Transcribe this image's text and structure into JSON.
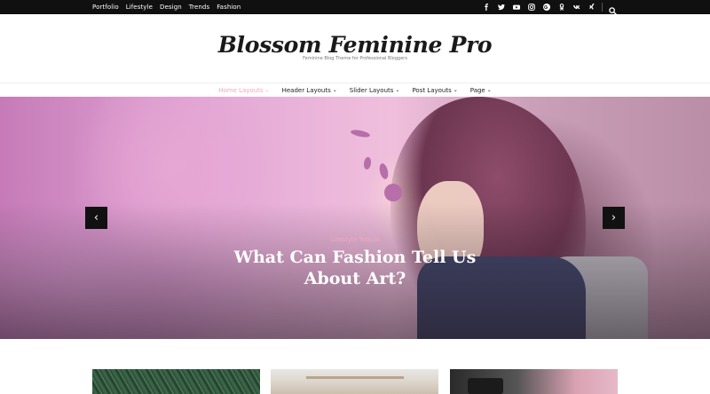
{
  "topbar": {
    "nav": [
      "Portfolio",
      "Lifestyle",
      "Design",
      "Trends",
      "Fashion"
    ],
    "social_icons": [
      "facebook-icon",
      "twitter-icon",
      "youtube-icon",
      "instagram-icon",
      "google-plus-icon",
      "odnoklassniki-icon",
      "vk-icon",
      "xing-icon"
    ]
  },
  "header": {
    "site_title": "Blossom Feminine Pro",
    "tagline": "Feminine Blog Theme for Professional Bloggers"
  },
  "main_nav": [
    {
      "label": "Home Layouts",
      "active": true
    },
    {
      "label": "Header Layouts",
      "active": false
    },
    {
      "label": "Slider Layouts",
      "active": false
    },
    {
      "label": "Post Layouts",
      "active": false
    },
    {
      "label": "Page",
      "active": false
    }
  ],
  "slider": {
    "categories": "Lifestyle  Trends",
    "headline": "What Can Fashion Tell Us About Art?",
    "prev_icon": "‹",
    "next_icon": "›"
  },
  "colors": {
    "accent": "#f2a7c0",
    "topbar_bg": "#101010"
  }
}
